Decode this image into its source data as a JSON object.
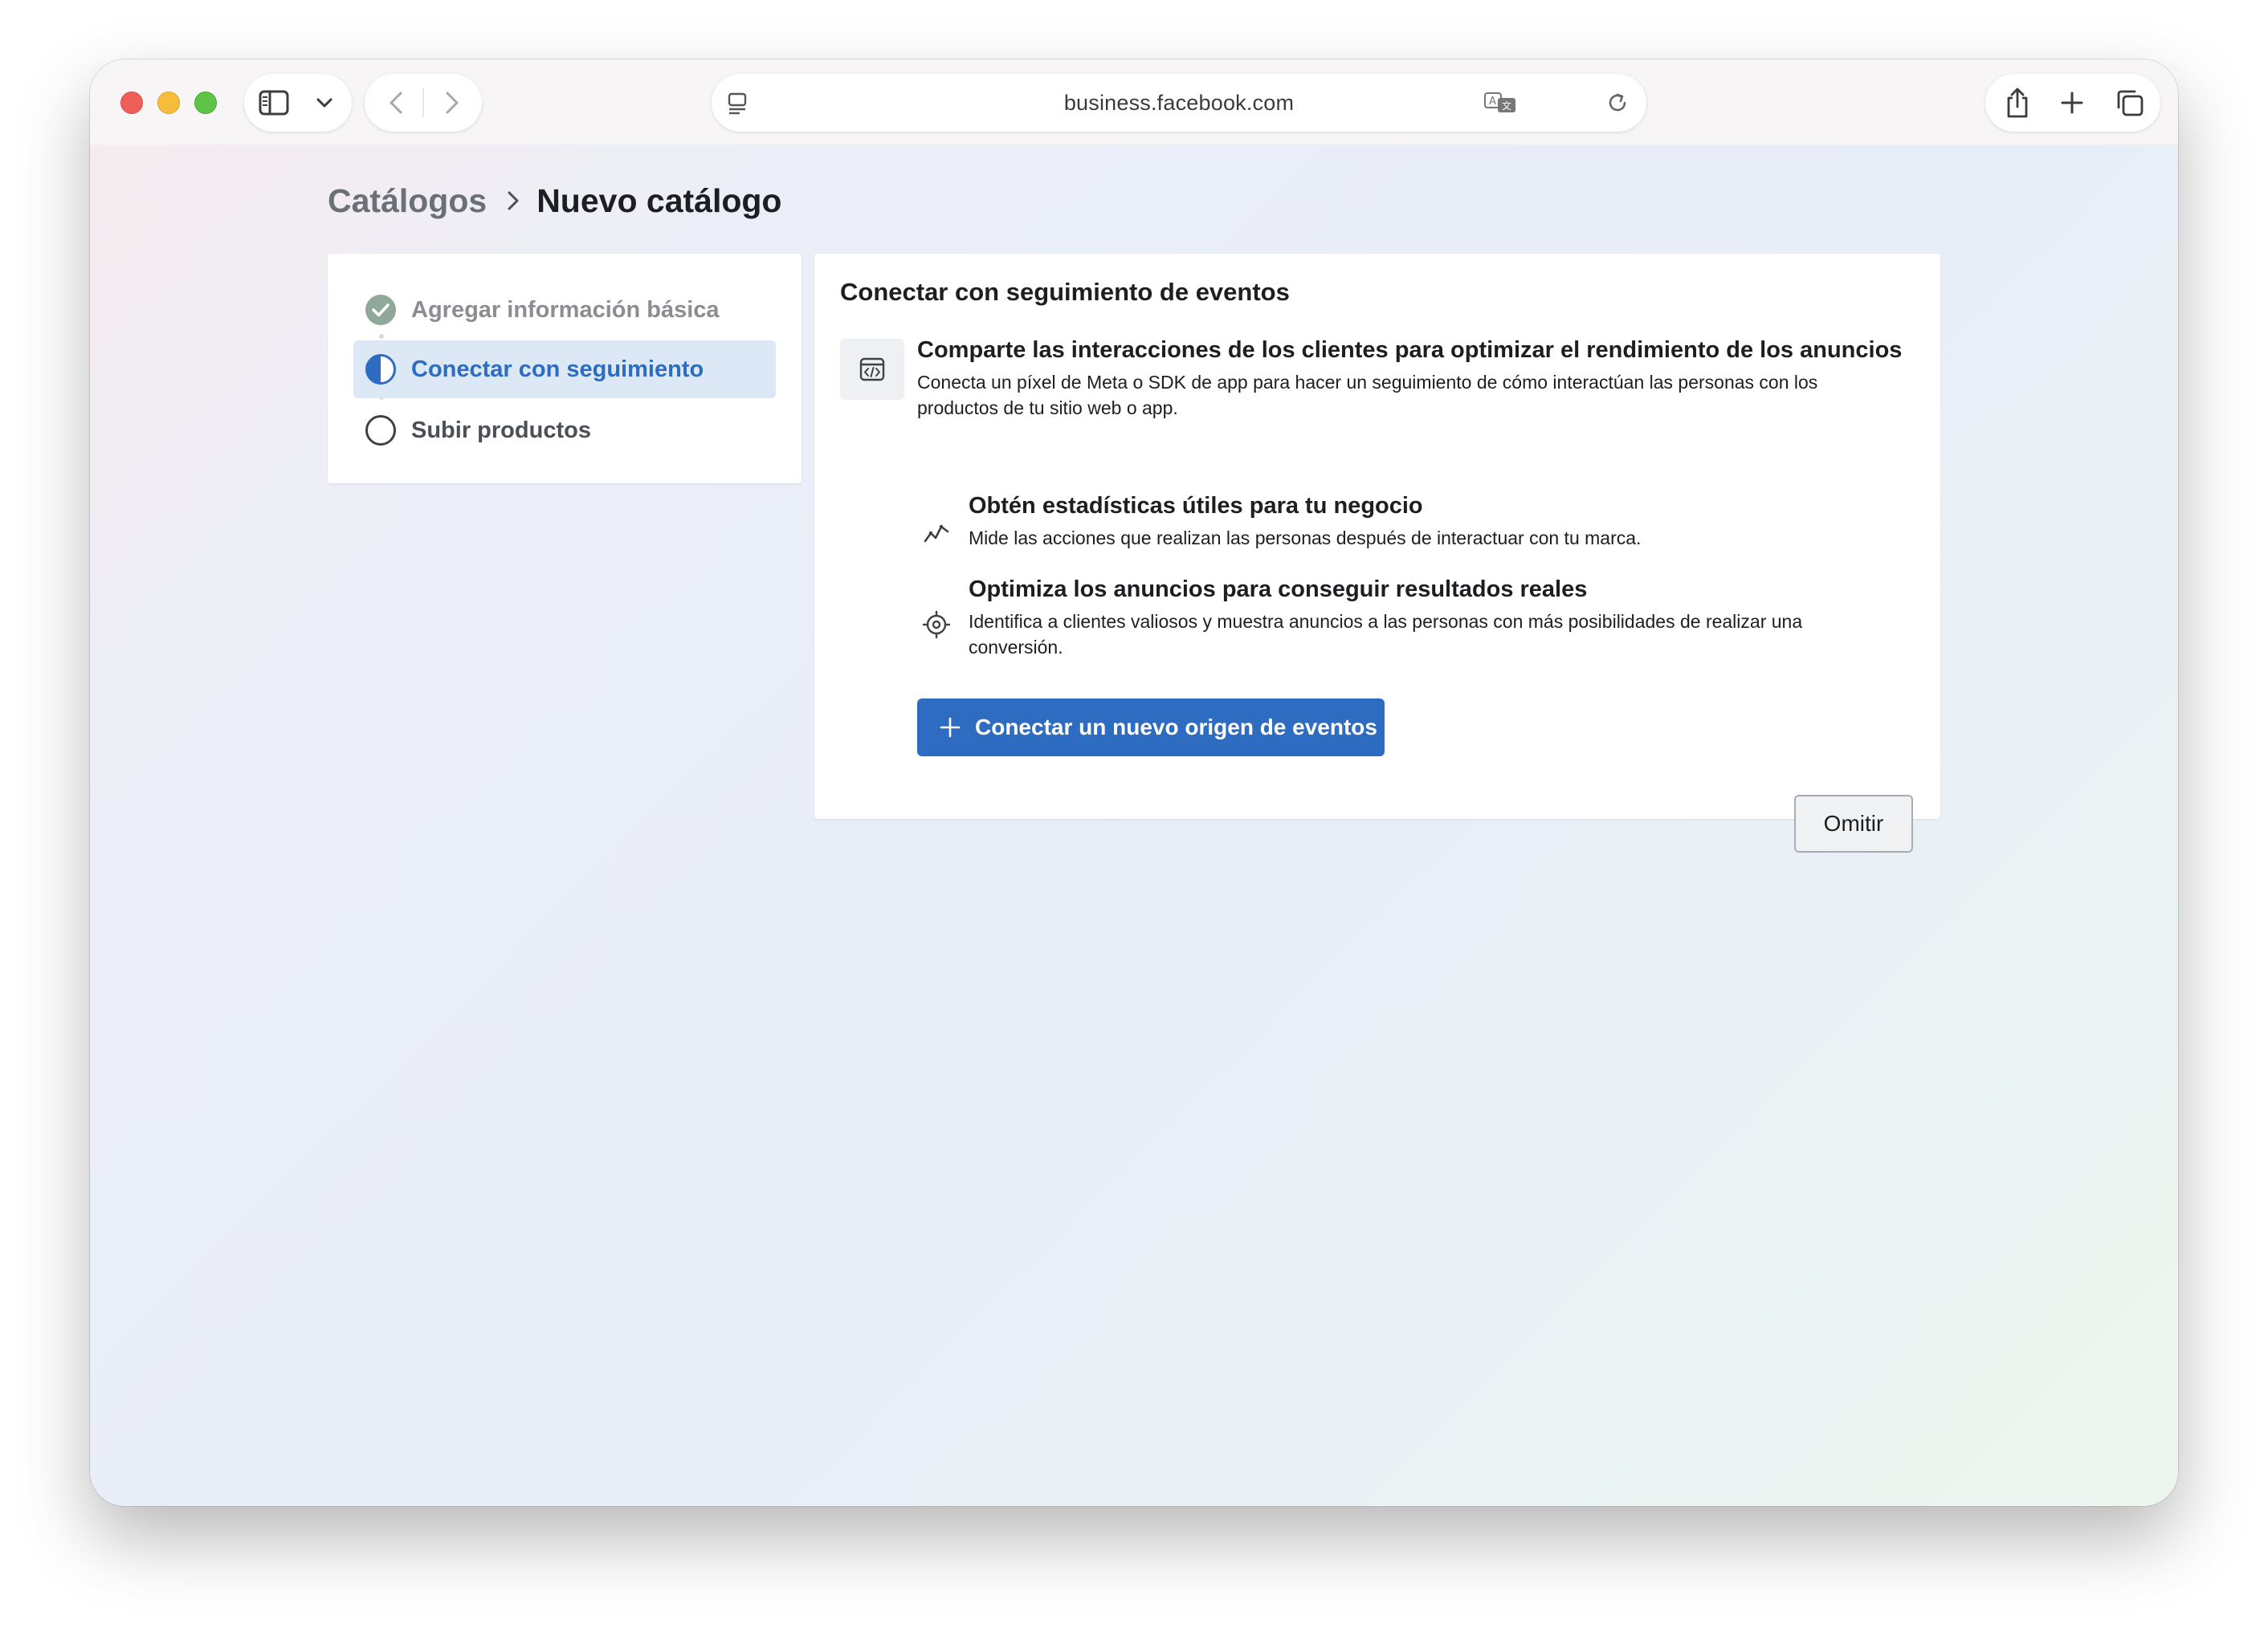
{
  "browser": {
    "url": "business.facebook.com"
  },
  "breadcrumb": {
    "parent": "Catálogos",
    "current": "Nuevo catálogo"
  },
  "steps": [
    {
      "label": "Agregar información básica",
      "status": "done"
    },
    {
      "label": "Conectar con seguimiento",
      "status": "active"
    },
    {
      "label": "Subir productos",
      "status": "todo"
    }
  ],
  "main": {
    "title": "Conectar con seguimiento de eventos",
    "feature": {
      "title": "Comparte las interacciones de los clientes para optimizar el rendimiento de los anuncios",
      "desc": "Conecta un píxel de Meta o SDK de app para hacer un seguimiento de cómo interactúan las personas con los productos de tu sitio web o app."
    },
    "benefits": [
      {
        "title": "Obtén estadísticas útiles para tu negocio",
        "desc": "Mide las acciones que realizan las personas después de interactuar con tu marca."
      },
      {
        "title": "Optimiza los anuncios para conseguir resultados reales",
        "desc": "Identifica a clientes valiosos y muestra anuncios a las personas con más posibilidades de realizar una conversión."
      }
    ],
    "primary_button": "Conectar un nuevo origen de eventos",
    "skip_button": "Omitir"
  },
  "colors": {
    "accent": "#2d6cc0",
    "active_step_bg": "#dde8f6",
    "done_check": "#8fa89a"
  }
}
